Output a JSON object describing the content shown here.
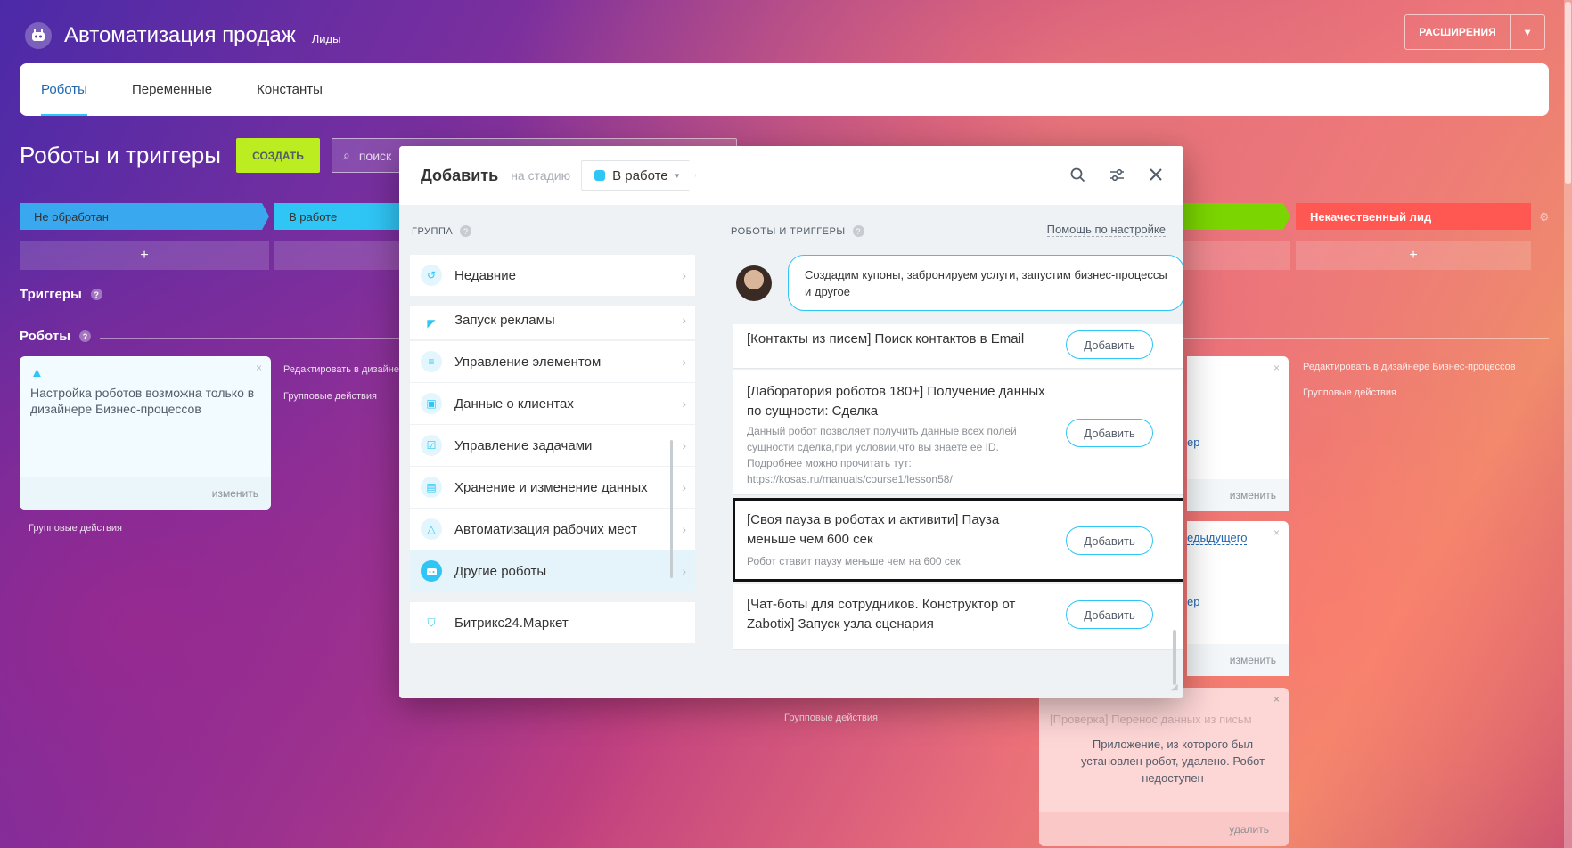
{
  "header": {
    "title": "Автоматизация продаж",
    "subtitle": "Лиды",
    "extensions_label": "РАСШИРЕНИЯ"
  },
  "tabs": [
    {
      "label": "Роботы"
    },
    {
      "label": "Переменные"
    },
    {
      "label": "Константы"
    }
  ],
  "page": {
    "title": "Роботы и триггеры",
    "create_label": "СОЗДАТЬ",
    "search_placeholder": "поиск"
  },
  "stages": [
    {
      "label": "Не обработан",
      "color": "#39a8ef"
    },
    {
      "label": "В работе",
      "color": "#2fc6f6"
    },
    {
      "label": "",
      "color": "#7bd500"
    },
    {
      "label": "Некачественный лид",
      "color": "#ff5752"
    }
  ],
  "plus": "+",
  "sections": {
    "triggers": "Триггеры",
    "robots": "Роботы"
  },
  "warn_card": {
    "text": "Настройка роботов возможна только в дизайнере Бизнес-процессов",
    "change": "изменить"
  },
  "side_links": {
    "edit_designer_short": "Редактировать в дизайнер",
    "edit_designer": "Редактировать в дизайнере Бизнес-процессов",
    "group_actions": "Групповые действия"
  },
  "right_cards": {
    "frag1": "ер",
    "frag2": "едыдущего",
    "frag3": "ер",
    "change": "изменить"
  },
  "pink_card": {
    "blur": "[Проверка] Перенос данных из письм",
    "text": "Приложение, из которого был установлен робот, удалено. Робот недоступен",
    "delete": "удалить"
  },
  "modal": {
    "title": "Добавить",
    "subtitle": "на стадию",
    "stage": "В работе",
    "left_heading": "ГРУППА",
    "right_heading": "РОБОТЫ И ТРИГГЕРЫ",
    "help": "Помощь по настройке",
    "bubble": "Создадим купоны, забронируем услуги, запустим бизнес-процессы и другое",
    "groups": [
      {
        "label": "Недавние",
        "icon": "history-icon"
      },
      {
        "label": "Запуск рекламы",
        "icon": "megaphone-icon"
      },
      {
        "label": "Управление элементом",
        "icon": "filter-icon"
      },
      {
        "label": "Данные о клиентах",
        "icon": "contact-card-icon"
      },
      {
        "label": "Управление задачами",
        "icon": "task-icon"
      },
      {
        "label": "Хранение и изменение данных",
        "icon": "database-icon"
      },
      {
        "label": "Автоматизация рабочих мест",
        "icon": "workflow-icon"
      },
      {
        "label": "Другие роботы",
        "icon": "robot-icon"
      },
      {
        "label": "Битрикс24.Маркет",
        "icon": "market-icon"
      }
    ],
    "robots": [
      {
        "title": "[Контакты из писем] Поиск контактов в Email",
        "desc": ""
      },
      {
        "title": "[Лаборатория роботов 180+] Получение данных по сущности: Сделка",
        "desc": "Данный робот позволяет получить данные всех полей сущности сделка,при условии,что вы знаете ее ID. Подробнее можно прочитать тут: https://kosas.ru/manuals/course1/lesson58/"
      },
      {
        "title": "[Своя пауза в роботах и активити] Пауза меньше чем 600 сек",
        "desc": "Робот ставит паузу меньше чем на 600 сек"
      },
      {
        "title": "[Чат-боты для сотрудников. Конструктор от Zabotix] Запуск узла сценария",
        "desc": ""
      }
    ],
    "add_label": "Добавить"
  }
}
